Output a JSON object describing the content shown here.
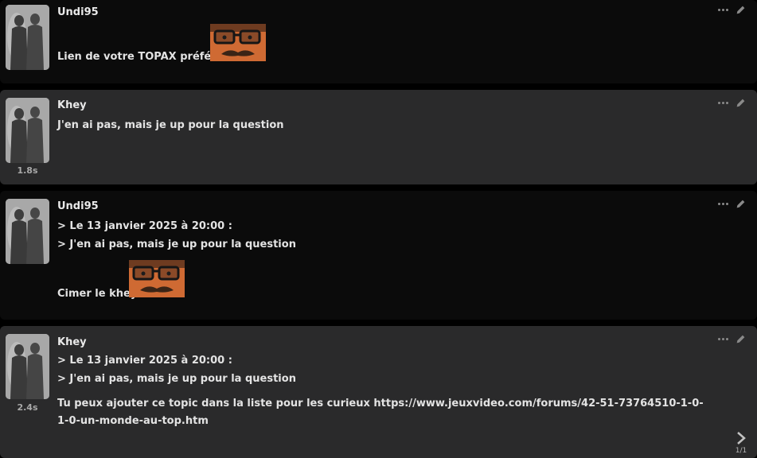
{
  "posts": [
    {
      "author": "Undi95",
      "time": "",
      "lines": [],
      "message": "Lien de votre TOPAX préféré ?",
      "avatar_icon": "avatar-silhouette-icon",
      "sticker_icon": "mustache-glasses-sticker"
    },
    {
      "author": "Khey",
      "time": "1.8s",
      "lines": [],
      "message": "J'en ai pas, mais je up pour la question",
      "avatar_icon": "avatar-silhouette-icon"
    },
    {
      "author": "Undi95",
      "time": "",
      "quote_header": "> Le 13 janvier 2025 à 20:00 :",
      "quote_text": "> J'en ai pas, mais je up pour la question",
      "message": "Cimer le khey",
      "avatar_icon": "avatar-silhouette-icon",
      "sticker_icon": "mustache-glasses-sticker"
    },
    {
      "author": "Khey",
      "time": "2.4s",
      "quote_header": "> Le 13 janvier 2025 à 20:00 :",
      "quote_text": "> J'en ai pas, mais je up pour la question",
      "message": "Tu peux ajouter ce topic dans la liste pour les curieux https://www.jeuxvideo.com/forums/42-51-73764510-1-0-1-0-un-monde-au-top.htm",
      "avatar_icon": "avatar-silhouette-icon"
    }
  ],
  "pager": {
    "label": "1/1",
    "next_icon": "chevron-right-icon"
  },
  "icons": {
    "more": "more-dots-icon",
    "edit": "pencil-icon"
  },
  "colors": {
    "post_dark": "#0b0b0b",
    "post_light": "#2a2a2b",
    "text": "#e3e3e3",
    "muted": "#a9a9a9"
  }
}
